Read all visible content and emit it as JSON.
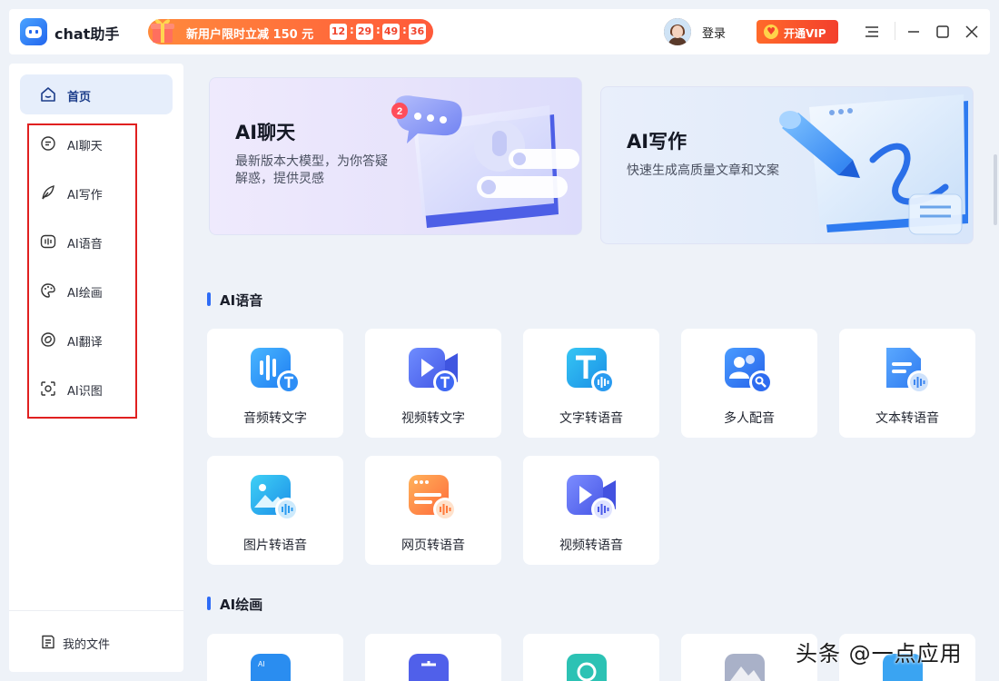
{
  "app": {
    "name": "chat助手"
  },
  "promo": {
    "text": "新用户限时立减 150 元",
    "countdown": [
      "12",
      "29",
      "49",
      "36"
    ]
  },
  "header": {
    "login_label": "登录",
    "vip_label": "开通VIP"
  },
  "sidebar": {
    "home_label": "首页",
    "items": [
      {
        "label": "AI聊天",
        "icon": "chat-bubble-icon"
      },
      {
        "label": "AI写作",
        "icon": "feather-pen-icon"
      },
      {
        "label": "AI语音",
        "icon": "audio-wave-icon"
      },
      {
        "label": "AI绘画",
        "icon": "palette-icon"
      },
      {
        "label": "AI翻译",
        "icon": "translate-icon"
      },
      {
        "label": "AI识图",
        "icon": "image-scan-icon"
      }
    ],
    "files_label": "我的文件"
  },
  "hero": {
    "chat": {
      "title": "AI聊天",
      "desc": "最新版本大模型，为你答疑解惑，提供灵感",
      "badge": "2"
    },
    "write": {
      "title": "AI写作",
      "desc": "快速生成高质量文章和文案"
    }
  },
  "sections": {
    "voice": {
      "title": "AI语音",
      "cards": [
        {
          "label": "音频转文字",
          "icon": "audio-to-text-icon"
        },
        {
          "label": "视频转文字",
          "icon": "video-to-text-icon"
        },
        {
          "label": "文字转语音",
          "icon": "text-to-speech-icon"
        },
        {
          "label": "多人配音",
          "icon": "multi-voice-icon"
        },
        {
          "label": "文本转语音",
          "icon": "document-to-speech-icon"
        },
        {
          "label": "图片转语音",
          "icon": "image-to-speech-icon"
        },
        {
          "label": "网页转语音",
          "icon": "webpage-to-speech-icon"
        },
        {
          "label": "视频转语音",
          "icon": "video-to-speech-icon"
        }
      ]
    },
    "paint": {
      "title": "AI绘画"
    }
  },
  "watermark": "头条 @一点应用",
  "colors": {
    "accent": "#2e6cf6",
    "promo": "#ff5a3a",
    "highlight_box": "#e02020"
  }
}
